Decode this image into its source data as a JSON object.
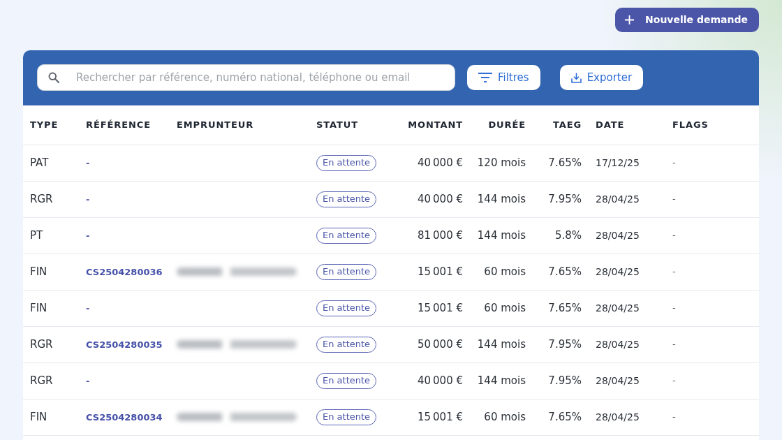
{
  "actions": {
    "new_request": {
      "label": "Nouvelle demande"
    }
  },
  "toolbar": {
    "search": {
      "placeholder": "Rechercher par référence, numéro national, téléphone ou email"
    },
    "buttons": [
      {
        "kind": "filter",
        "label": "Filtres"
      },
      {
        "kind": "export",
        "label": "Exporter"
      }
    ]
  },
  "table": {
    "columns": [
      "TYPE",
      "RÉFÉRENCE",
      "EMPRUNTEUR",
      "STATUT",
      "MONTANT",
      "DURÉE",
      "TAEG",
      "DATE",
      "FLAGS"
    ],
    "rows": [
      {
        "type": "PAT",
        "reference": "-",
        "borrower_blurred": false,
        "status": "En attente",
        "amount": "40 000 €",
        "duration": "120 mois",
        "taeg": "7.65%",
        "date": "17/12/25",
        "flags": "-"
      },
      {
        "type": "RGR",
        "reference": "-",
        "borrower_blurred": false,
        "status": "En attente",
        "amount": "40 000 €",
        "duration": "144 mois",
        "taeg": "7.95%",
        "date": "28/04/25",
        "flags": "-"
      },
      {
        "type": "PT",
        "reference": "-",
        "borrower_blurred": false,
        "status": "En attente",
        "amount": "81 000 €",
        "duration": "144 mois",
        "taeg": "5.8%",
        "date": "28/04/25",
        "flags": "-"
      },
      {
        "type": "FIN",
        "reference": "CS2504280036",
        "borrower_blurred": true,
        "status": "En attente",
        "amount": "15 001 €",
        "duration": "60 mois",
        "taeg": "7.65%",
        "date": "28/04/25",
        "flags": "-"
      },
      {
        "type": "FIN",
        "reference": "-",
        "borrower_blurred": false,
        "status": "En attente",
        "amount": "15 001 €",
        "duration": "60 mois",
        "taeg": "7.65%",
        "date": "28/04/25",
        "flags": "-"
      },
      {
        "type": "RGR",
        "reference": "CS2504280035",
        "borrower_blurred": true,
        "status": "En attente",
        "amount": "50 000 €",
        "duration": "144 mois",
        "taeg": "7.95%",
        "date": "28/04/25",
        "flags": "-"
      },
      {
        "type": "RGR",
        "reference": "-",
        "borrower_blurred": false,
        "status": "En attente",
        "amount": "40 000 €",
        "duration": "144 mois",
        "taeg": "7.95%",
        "date": "28/04/25",
        "flags": "-"
      },
      {
        "type": "FIN",
        "reference": "CS2504280034",
        "borrower_blurred": true,
        "status": "En attente",
        "amount": "15 001 €",
        "duration": "60 mois",
        "taeg": "7.65%",
        "date": "28/04/25",
        "flags": "-"
      }
    ]
  }
}
